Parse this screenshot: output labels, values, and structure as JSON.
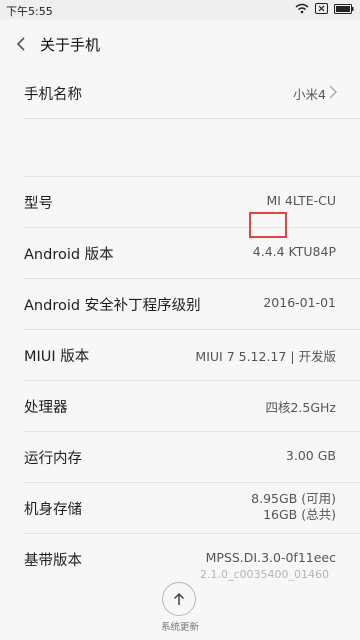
{
  "status_bar": {
    "time": "下午5:55"
  },
  "header": {
    "title": "关于手机"
  },
  "rows": {
    "phone_name": {
      "label": "手机名称",
      "value": "小米4"
    },
    "model": {
      "label": "型号",
      "value": "MI 4LTE-CU"
    },
    "android_version": {
      "label": "Android 版本",
      "value": "4.4.4 KTU84P"
    },
    "security_patch": {
      "label": "Android 安全补丁程序级别",
      "value": "2016-01-01"
    },
    "miui_version": {
      "label": "MIUI 版本",
      "value": "MIUI 7 5.12.17 | 开发版"
    },
    "processor": {
      "label": "处理器",
      "value": "四核2.5GHz"
    },
    "ram": {
      "label": "运行内存",
      "value": "3.00 GB"
    },
    "storage": {
      "label": "机身存储",
      "value_line1": "8.95GB (可用)",
      "value_line2": "16GB (总共)"
    },
    "baseband": {
      "label": "基带版本",
      "value": "MPSS.DI.3.0-0f11eec"
    }
  },
  "partial_row_text": "2.1.0_c0035400_01460",
  "bottom": {
    "update_label": "系统更新"
  },
  "colors": {
    "highlight": "#e0463f",
    "background": "#f7f7f7"
  },
  "icons": {
    "back": "chevron-left-icon",
    "arrow_up": "arrow-up-icon",
    "chevron_right": "chevron-right-icon"
  }
}
